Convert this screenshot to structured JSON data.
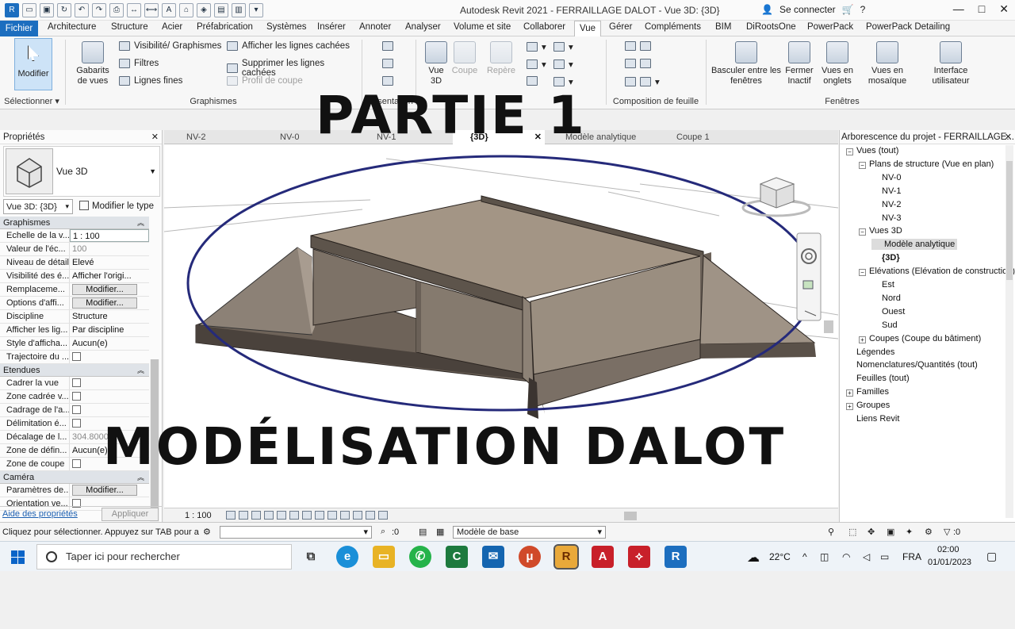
{
  "window": {
    "title": "Autodesk Revit 2021 - FERRAILLAGE DALOT - Vue 3D: {3D}",
    "connect": "Se connecter"
  },
  "tabs": [
    "Fichier",
    "Architecture",
    "Structure",
    "Acier",
    "Préfabrication",
    "Systèmes",
    "Insérer",
    "Annoter",
    "Analyser",
    "Volume et site",
    "Collaborer",
    "Vue",
    "Gérer",
    "Compléments",
    "BIM",
    "DiRootsOne",
    "PowerPack",
    "PowerPack Detailing"
  ],
  "active_tab": "Vue",
  "ribbon": {
    "select_group": {
      "modify": "Modifier",
      "label": "Sélectionner"
    },
    "graphics": {
      "templates": "Gabarits de vues",
      "vis": "Visibilité/ Graphismes",
      "filters": "Filtres",
      "thin": "Lignes fines",
      "show_hidden": "Afficher les lignes cachées",
      "remove_hidden": "Supprimer les lignes cachées",
      "cut_profile": "Profil de coupe",
      "label": "Graphismes"
    },
    "create": {
      "view3d": "Vue 3D",
      "section": "Coupe",
      "callout": "Repère"
    },
    "present_label": "Présentation",
    "sheet_label": "Composition de feuille",
    "windows": {
      "switch": "Basculer entre les fenêtres",
      "close_inactive": "Fermer Inactif",
      "tab_views": "Vues en onglets",
      "tile_views": "Vues en mosaïque",
      "ui": "Interface utilisateur",
      "label": "Fenêtres"
    }
  },
  "overlay": {
    "title": "PARTIE 1",
    "subtitle": "MODÉLISATION DALOT"
  },
  "properties": {
    "header": "Propriétés",
    "type_name": "Vue 3D",
    "instance": "Vue 3D: {3D}",
    "edit_type": "Modifier le type",
    "sections": [
      {
        "name": "Graphismes",
        "rows": [
          {
            "label": "Echelle de la v...",
            "value": "1 : 100",
            "kind": "input"
          },
          {
            "label": "Valeur de l'éc...",
            "value": "100",
            "kind": "gray"
          },
          {
            "label": "Niveau de détail",
            "value": "Elevé",
            "kind": "text"
          },
          {
            "label": "Visibilité des é...",
            "value": "Afficher l'origi...",
            "kind": "text"
          },
          {
            "label": "Remplaceme...",
            "value": "Modifier...",
            "kind": "button"
          },
          {
            "label": "Options d'affi...",
            "value": "Modifier...",
            "kind": "button"
          },
          {
            "label": "Discipline",
            "value": "Structure",
            "kind": "text"
          },
          {
            "label": "Afficher les lig...",
            "value": "Par discipline",
            "kind": "text"
          },
          {
            "label": "Style d'afficha...",
            "value": "Aucun(e)",
            "kind": "text"
          },
          {
            "label": "Trajectoire du ...",
            "value": "",
            "kind": "check"
          }
        ]
      },
      {
        "name": "Etendues",
        "rows": [
          {
            "label": "Cadrer la vue",
            "value": "",
            "kind": "check"
          },
          {
            "label": "Zone cadrée v...",
            "value": "",
            "kind": "check"
          },
          {
            "label": "Cadrage de l'a...",
            "value": "",
            "kind": "check"
          },
          {
            "label": "Délimitation é...",
            "value": "",
            "kind": "check"
          },
          {
            "label": "Décalage de l...",
            "value": "304.8000",
            "kind": "gray"
          },
          {
            "label": "Zone de défin...",
            "value": "Aucun(e)",
            "kind": "text"
          },
          {
            "label": "Zone de coupe",
            "value": "",
            "kind": "check"
          }
        ]
      },
      {
        "name": "Caméra",
        "rows": [
          {
            "label": "Paramètres de...",
            "value": "Modifier...",
            "kind": "button"
          },
          {
            "label": "Orientation ve...",
            "value": "",
            "kind": "check"
          }
        ]
      }
    ],
    "help": "Aide des propriétés",
    "apply": "Appliquer"
  },
  "view_tabs": [
    {
      "label": "NV-2",
      "active": false
    },
    {
      "label": "NV-0",
      "active": false
    },
    {
      "label": "NV-1",
      "active": false
    },
    {
      "label": "{3D}",
      "active": true
    },
    {
      "label": "Modèle analytique",
      "active": false
    },
    {
      "label": "Coupe 1",
      "active": false
    }
  ],
  "view_control": {
    "scale": "1 : 100"
  },
  "browser": {
    "header": "Arborescence du projet - FERRAILLAGE...",
    "nodes": [
      {
        "label": "Vues (tout)",
        "level": 0,
        "toggle": "−"
      },
      {
        "label": "Plans de structure (Vue en plan)",
        "level": 1,
        "toggle": "−"
      },
      {
        "label": "NV-0",
        "level": 2,
        "toggle": ""
      },
      {
        "label": "NV-1",
        "level": 2,
        "toggle": ""
      },
      {
        "label": "NV-2",
        "level": 2,
        "toggle": ""
      },
      {
        "label": "NV-3",
        "level": 2,
        "toggle": ""
      },
      {
        "label": "Vues 3D",
        "level": 1,
        "toggle": "−"
      },
      {
        "label": "Modèle analytique",
        "level": 2,
        "toggle": "",
        "selected": true
      },
      {
        "label": "{3D}",
        "level": 2,
        "toggle": "",
        "bold": true
      },
      {
        "label": "Elévations (Elévation de construction)",
        "level": 1,
        "toggle": "−"
      },
      {
        "label": "Est",
        "level": 2,
        "toggle": ""
      },
      {
        "label": "Nord",
        "level": 2,
        "toggle": ""
      },
      {
        "label": "Ouest",
        "level": 2,
        "toggle": ""
      },
      {
        "label": "Sud",
        "level": 2,
        "toggle": ""
      },
      {
        "label": "Coupes (Coupe du bâtiment)",
        "level": 1,
        "toggle": "+"
      },
      {
        "label": "Légendes",
        "level": 0,
        "toggle": ""
      },
      {
        "label": "Nomenclatures/Quantités (tout)",
        "level": 0,
        "toggle": ""
      },
      {
        "label": "Feuilles (tout)",
        "level": 0,
        "toggle": ""
      },
      {
        "label": "Familles",
        "level": 0,
        "toggle": "+"
      },
      {
        "label": "Groupes",
        "level": 0,
        "toggle": "+"
      },
      {
        "label": "Liens Revit",
        "level": 0,
        "toggle": ""
      }
    ]
  },
  "status": {
    "message": "Cliquez pour sélectionner. Appuyez sur TAB pour a",
    "workset_zero": ":0",
    "model": "Modèle de base",
    "filter_zero": ":0"
  },
  "taskbar": {
    "search": "Taper ici pour rechercher",
    "temp": "22°C",
    "lang": "FRA",
    "time": "02:00",
    "date": "01/01/2023"
  }
}
